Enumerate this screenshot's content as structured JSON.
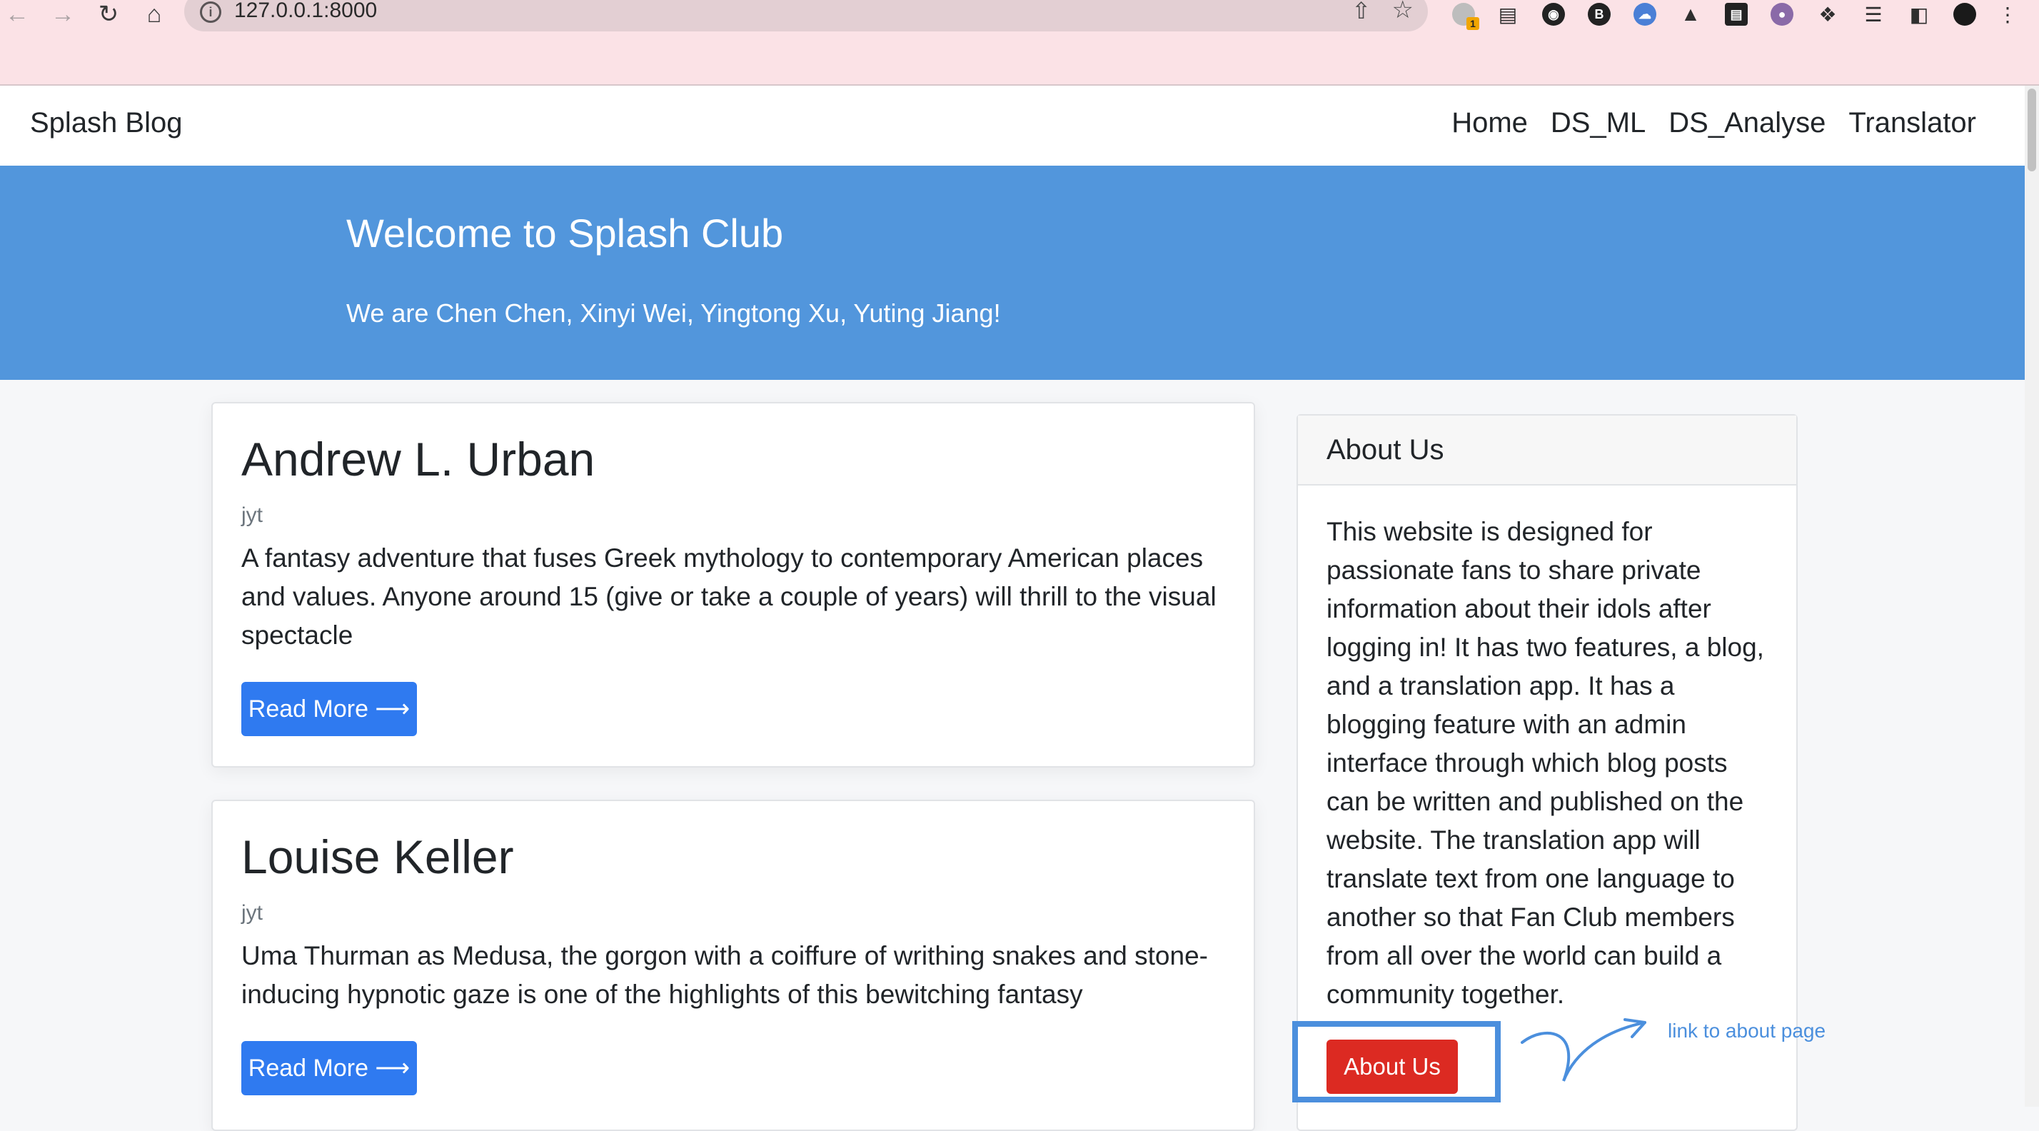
{
  "browser": {
    "url": "127.0.0.1:8000",
    "icons": [
      "back-icon",
      "forward-icon",
      "reload-icon",
      "home-icon",
      "info-icon",
      "share-icon",
      "star-icon"
    ],
    "extensions_badge": "1"
  },
  "site": {
    "brand": "Splash Blog",
    "nav": [
      "Home",
      "DS_ML",
      "DS_Analyse",
      "Translator"
    ]
  },
  "hero": {
    "title": "Welcome to Splash Club",
    "subtitle": "We are Chen Chen, Xinyi Wei, Yingtong Xu, Yuting Jiang!"
  },
  "posts": [
    {
      "title": "Andrew L. Urban",
      "author": "jyt",
      "body": "A fantasy adventure that fuses Greek mythology to contemporary American places and values. Anyone around 15 (give or take a couple of years) will thrill to the visual spectacle",
      "button": "Read More ⟶"
    },
    {
      "title": "Louise Keller",
      "author": "jyt",
      "body": "Uma Thurman as Medusa, the gorgon with a coiffure of writhing snakes and stone-inducing hypnotic gaze is one of the highlights of this bewitching fantasy",
      "button": "Read More ⟶"
    }
  ],
  "about": {
    "heading": "About Us",
    "body": "This website is designed for passionate fans to share private information about their idols after logging in! It has two features, a blog, and a translation app. It has a blogging feature with an admin interface through which blog posts can be written and published on the website. The translation app will translate text from one language to another so that Fan Club members from all over the world can build a community together.",
    "button": "About Us"
  },
  "annotation": {
    "text": "link to about page",
    "color": "#4b8fdd"
  },
  "colors": {
    "hero_bg": "#5296dc",
    "primary_button": "#2f7af0",
    "danger_button": "#dc2a22",
    "chrome_bg": "#fbe2e6"
  }
}
